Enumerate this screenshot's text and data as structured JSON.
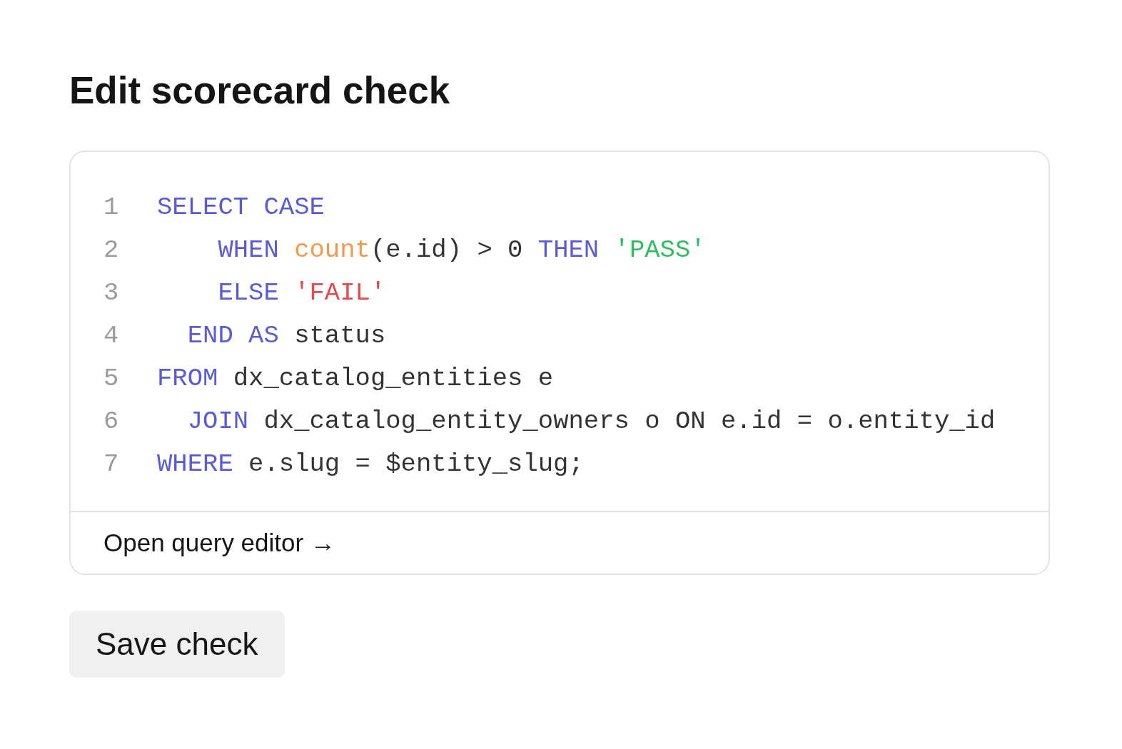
{
  "title": "Edit scorecard check",
  "editor": {
    "lines": [
      {
        "number": "1",
        "tokens": [
          {
            "text": "SELECT CASE",
            "color": "#5b5bd6"
          }
        ]
      },
      {
        "number": "2",
        "tokens": [
          {
            "text": "    WHEN ",
            "color": "#5b5bd6"
          },
          {
            "text": "count",
            "color": "#f2994a"
          },
          {
            "text": "(e.id) > 0 ",
            "color": "#333333"
          },
          {
            "text": "THEN ",
            "color": "#5b5bd6"
          },
          {
            "text": "'PASS'",
            "color": "#2ebd63"
          }
        ]
      },
      {
        "number": "3",
        "tokens": [
          {
            "text": "    ELSE ",
            "color": "#5b5bd6"
          },
          {
            "text": "'FAIL'",
            "color": "#e5484d"
          }
        ]
      },
      {
        "number": "4",
        "tokens": [
          {
            "text": "  END AS ",
            "color": "#5b5bd6"
          },
          {
            "text": "status",
            "color": "#333333"
          }
        ]
      },
      {
        "number": "5",
        "tokens": [
          {
            "text": "FROM ",
            "color": "#5b5bd6"
          },
          {
            "text": "dx_catalog_entities e",
            "color": "#333333"
          }
        ]
      },
      {
        "number": "6",
        "tokens": [
          {
            "text": "  JOIN ",
            "color": "#5b5bd6"
          },
          {
            "text": "dx_catalog_entity_owners o ON e.id = o.entity_id",
            "color": "#333333"
          }
        ]
      },
      {
        "number": "7",
        "tokens": [
          {
            "text": "WHERE ",
            "color": "#5b5bd6"
          },
          {
            "text": "e.slug = $entity_slug;",
            "color": "#333333"
          }
        ]
      }
    ],
    "footer_link": "Open query editor →"
  },
  "buttons": [
    "Save check"
  ]
}
